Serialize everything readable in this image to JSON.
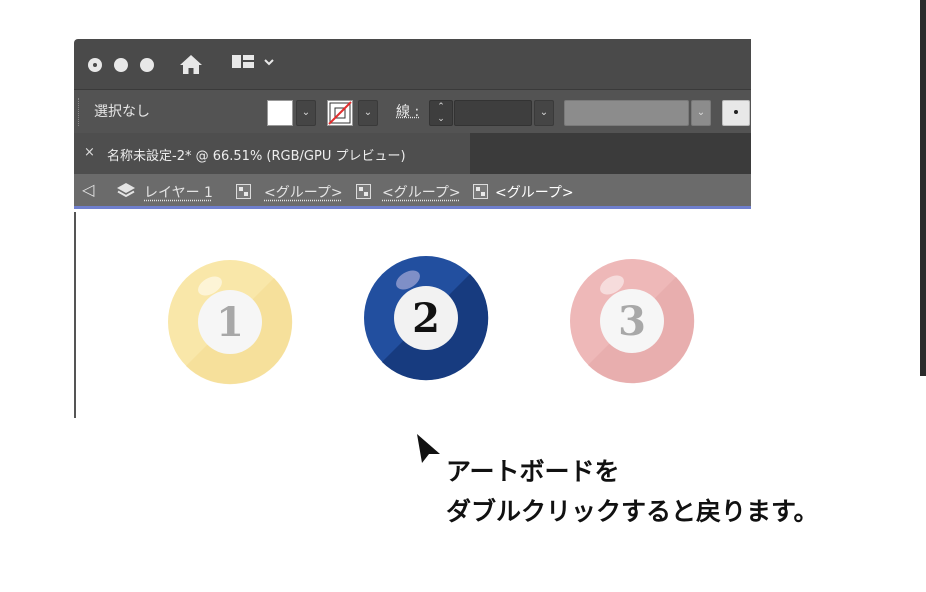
{
  "window": {
    "controls": [
      "close-button",
      "minimize-button",
      "zoom-button"
    ]
  },
  "controlbar": {
    "selection_label": "選択なし",
    "fill_color": "#ffffff",
    "stroke_color": "none",
    "stroke_label": "線 :"
  },
  "document_tab": {
    "close_glyph": "×",
    "title": "名称未設定-2* @ 66.51% (RGB/GPU プレビュー)"
  },
  "isolation_bar": {
    "back_glyph": "◁",
    "layer_label": "レイヤー 1",
    "groups": [
      "<グループ>",
      "<グループ>",
      "<グループ>"
    ]
  },
  "balls": [
    {
      "number": "1",
      "color": "#f7dc6f",
      "state": "dimmed"
    },
    {
      "number": "2",
      "color": "#1c3d8e",
      "state": "active"
    },
    {
      "number": "3",
      "color": "#e07b7b",
      "state": "dimmed"
    }
  ],
  "caption": {
    "line1": "アートボードを",
    "line2": "ダブルクリックすると戻ります。"
  },
  "colors": {
    "isolation_accent": "#6f7fce",
    "titlebar": "#4a4a4a",
    "controlbar": "#535353"
  }
}
